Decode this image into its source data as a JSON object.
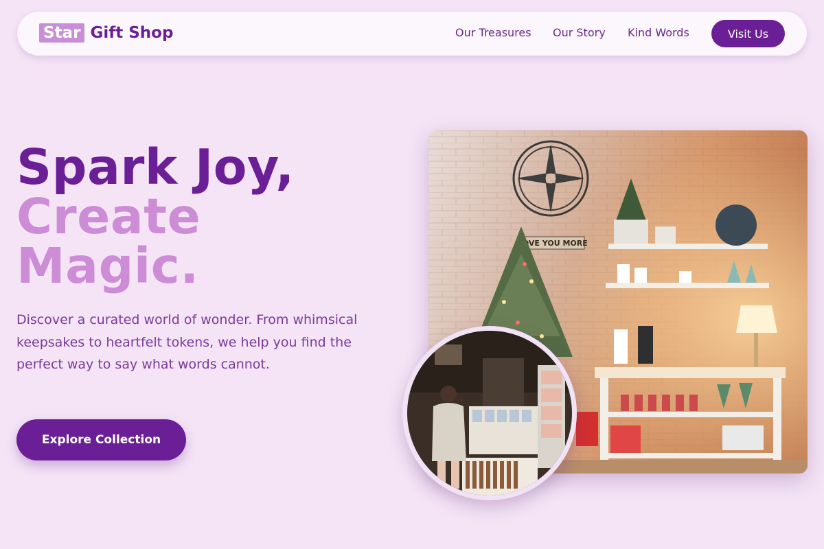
{
  "brand": {
    "badge": "Star",
    "name": "Gift Shop"
  },
  "nav": {
    "links": [
      "Our Treasures",
      "Our Story",
      "Kind Words"
    ],
    "cta": "Visit Us"
  },
  "hero": {
    "headline_line1": "Spark Joy,",
    "headline_line2": "Create",
    "headline_line3": "Magic.",
    "description": "Discover a curated world of wonder. From whimsical keepsakes to heartfelt tokens, we help you find the perfect way to say what words cannot.",
    "cta": "Explore Collection"
  },
  "images": {
    "main_photo_sign": "LOVE YOU MORE",
    "main_photo": "shop-interior-brick-wall-tree-photo",
    "circle_photo": "card-rack-browsing-photo"
  },
  "colors": {
    "background": "#f4e4f6",
    "primary": "#6a1f96",
    "accent": "#cd8dd6",
    "body_text": "#7a3a98"
  }
}
